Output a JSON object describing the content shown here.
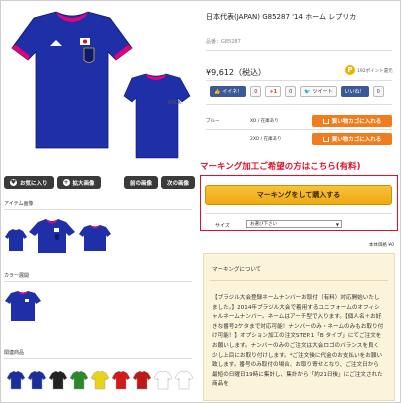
{
  "product": {
    "title": "日本代表(JAPAN) G85287 '14 ホーム レプリカ",
    "code": "品番：G85287",
    "price": "¥9,612（税込）",
    "points_coin": "P",
    "points": "192ポイント還元",
    "back_label": "BACK"
  },
  "social": {
    "facebook": "イイネ！",
    "facebook_count": "0",
    "gplus": "+1",
    "gplus_count": "0",
    "tweet": "ツイート",
    "hatena": "いいね！",
    "hatena_count": "0"
  },
  "stock_rows": [
    {
      "color": "ブルー",
      "size": "XO / 在庫あり",
      "button": "買い物カゴに入れる"
    },
    {
      "color": "",
      "size": "2XO / 在庫あり",
      "button": "買い物カゴに入れる"
    }
  ],
  "image_buttons": {
    "favorite": "お気に入り",
    "zoom": "拡大画像",
    "prev": "前の画像",
    "next": "次の画像"
  },
  "sections": {
    "item_images": "アイテム画像",
    "color_variations": "カラー展開",
    "related": "関連商品"
  },
  "marking": {
    "heading": "マーキング加工ご希望の方はこちら(有料)",
    "buy_button": "マーキングをして購入する",
    "size_label": "サイズ",
    "size_select": "お選び下さい",
    "body_price": "本体価格 ¥0"
  },
  "description": {
    "title": "マーキングについて",
    "text": "【ブラジル大会登録ネームナンバーお取付（有料）対応開始いたしました。】2014年ブラジル大会で着用するユニフォームのオフィシャルネームナンバー。ネームはアーチ型で入ります。【個人名＋お好きな番号2ケタまで対応可能！ナンバーのみ・ネームのみもお取り付け可能！】オプション加工の注文STEP.1「B タイプ」にてご注文をお願いします。ナンバーのみのご注文は大会ロゴのバランスを良く少し上目にお取り付けします。*ご注文後に代金のお支払いをお願い致します。番号のみ取付の場合、お取り寄せとなり、ご注文日から最短の日曜日19時に集計し、集計から「約21日後」にご注文された商品を"
  },
  "colors": {
    "jersey_blue": "#1f2fa8",
    "accent_pink": "#e6007e",
    "cart_orange": "#f07c1e",
    "marking_red": "#e0102a",
    "marking_yellow": "#f5b62a"
  },
  "related_jerseys": [
    "#1a2f9b",
    "#1a2f9b",
    "#222222",
    "#2a8a2a",
    "#e8d21a",
    "#d11a1a",
    "#c01818",
    "#ffffff",
    "#ffffff"
  ]
}
